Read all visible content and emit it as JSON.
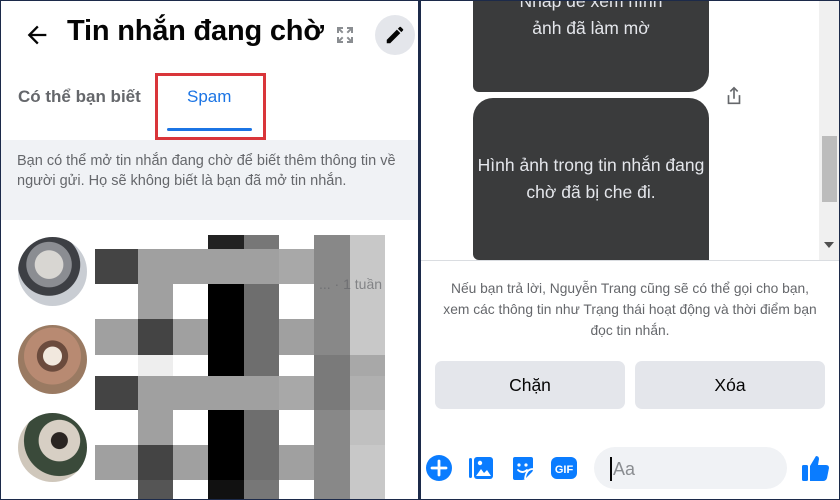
{
  "left_panel": {
    "header": {
      "back_icon": "arrow-left-icon",
      "title": "Tin nhắn đang chờ",
      "expand_icon": "expand-icon",
      "edit_icon": "pencil-icon"
    },
    "tabs": [
      {
        "label": "Có thể bạn biết",
        "active": false
      },
      {
        "label": "Spam",
        "active": true
      }
    ],
    "info_text": "Bạn có thể mở tin nhắn đang chờ để biết thêm thông tin về người gửi. Họ sẽ không biết là bạn đã mở tin nhắn.",
    "conversations": [
      {
        "avatar": "avatar-man-photo",
        "time": "... · 1 tuần",
        "blurred": true
      },
      {
        "avatar": "avatar-woman-photo",
        "blurred": true
      },
      {
        "avatar": "avatar-piano-photo",
        "blurred": true
      }
    ]
  },
  "right_panel": {
    "messages": [
      {
        "text_line_1": "Nhấp để xem hình",
        "text_line_2": "ảnh đã làm mờ"
      },
      {
        "text": "Hình ảnh trong tin nhắn đang chờ đã bị che đi."
      }
    ],
    "share_icon": "share-icon",
    "notice_text": "Nếu bạn trả lời, Nguyễn Trang cũng sẽ có thể gọi cho bạn, xem các thông tin như Trạng thái hoạt động và thời điểm bạn đọc tin nhắn.",
    "buttons": {
      "block": "Chặn",
      "delete": "Xóa"
    },
    "composer": {
      "placeholder": "Aa",
      "icons": [
        "plus-circle-icon",
        "photo-icon",
        "sticker-icon",
        "gif-icon",
        "emoji-icon",
        "thumbs-up-icon"
      ],
      "gif_label": "GIF"
    }
  },
  "colors": {
    "accent": "#1b74e4",
    "highlight_box": "#d9353a",
    "bubble": "#3a3b3c",
    "button_bg": "#e4e6eb",
    "info_bg": "#f0f2f5",
    "messenger_blue": "#0a7cff"
  }
}
